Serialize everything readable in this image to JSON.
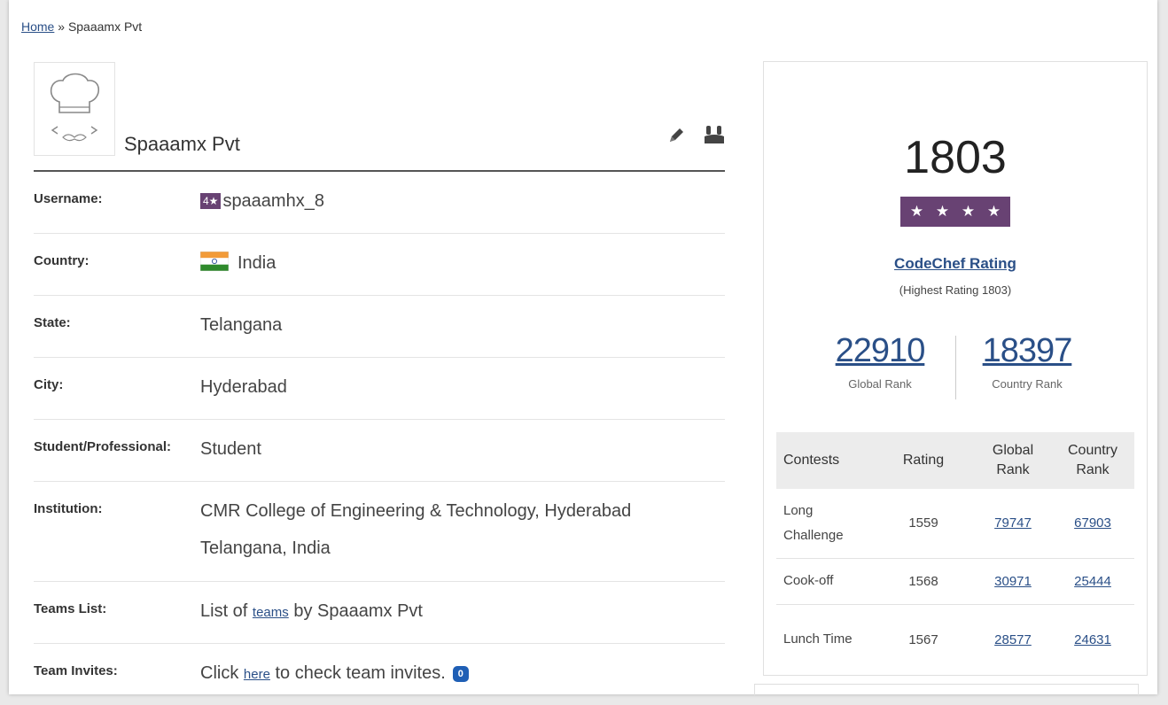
{
  "breadcrumb": {
    "home": "Home",
    "separator": "»",
    "current": "Spaaamx Pvt"
  },
  "profile": {
    "name": "Spaaamx Pvt",
    "fields": [
      {
        "label": "Username:",
        "value": "spaaamhx_8",
        "badge": "4★"
      },
      {
        "label": "Country:",
        "value": "India"
      },
      {
        "label": "State:",
        "value": "Telangana"
      },
      {
        "label": "City:",
        "value": "Hyderabad"
      },
      {
        "label": "Student/Professional:",
        "value": "Student"
      },
      {
        "label": "Institution:",
        "value_line1": "CMR College of Engineering & Technology, Hyderabad",
        "value_line2": "Telangana, India"
      },
      {
        "label": "Teams List:",
        "prefix": "List of ",
        "link": "teams",
        "suffix": " by Spaaamx Pvt"
      },
      {
        "label": "Team Invites:",
        "prefix": "Click ",
        "link": "here",
        "suffix": " to check team invites.",
        "count": "0"
      }
    ]
  },
  "rating": {
    "value": "1803",
    "stars": [
      "★",
      "★",
      "★",
      "★"
    ],
    "link_label": "CodeChef Rating",
    "highest": "(Highest Rating 1803)",
    "global_rank": "22910",
    "global_rank_label": "Global Rank",
    "country_rank": "18397",
    "country_rank_label": "Country Rank"
  },
  "contests": {
    "headers": {
      "contests": "Contests",
      "rating": "Rating",
      "global": "Global Rank",
      "country": "Country Rank"
    },
    "rows": [
      {
        "name": "Long Challenge",
        "rating": "1559",
        "global": "79747",
        "country": "67903"
      },
      {
        "name": "Cook-off",
        "rating": "1568",
        "global": "30971",
        "country": "25444"
      },
      {
        "name": "Lunch Time",
        "rating": "1567",
        "global": "28577",
        "country": "24631"
      }
    ]
  },
  "colors": {
    "link": "#2a4f87",
    "star_badge": "#684273",
    "invite_badge": "#1f5fb5"
  }
}
